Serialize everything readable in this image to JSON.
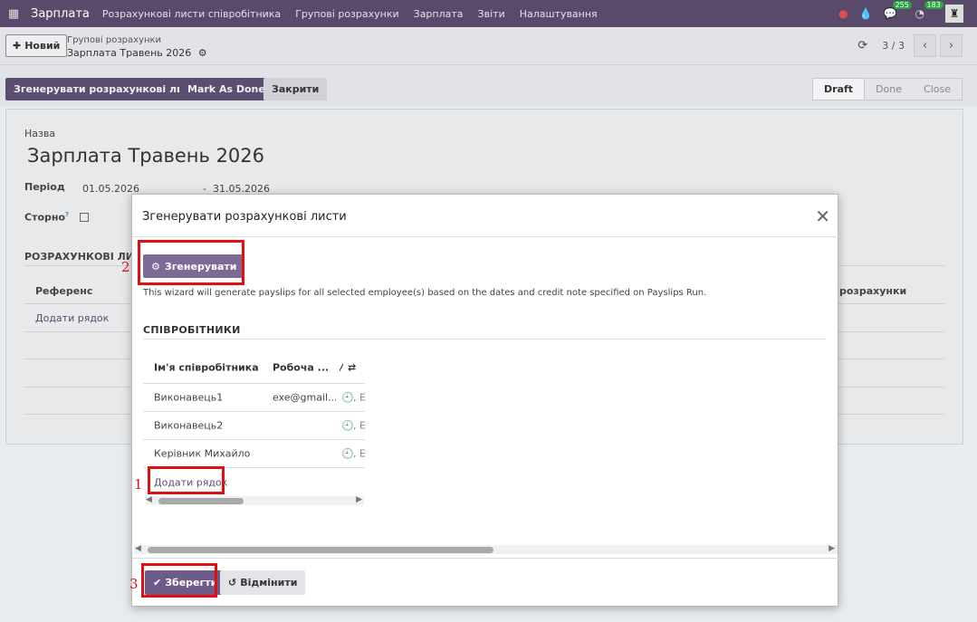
{
  "navbar": {
    "brand": "Зарплата",
    "menu": [
      "Розрахункові листи співробітника",
      "Групові розрахунки",
      "Зарплата",
      "Звіти",
      "Налаштування"
    ],
    "messages_count": "255",
    "activities_count": "183"
  },
  "control": {
    "new_label": "Новий",
    "breadcrumb_parent": "Групові розрахунки",
    "breadcrumb_current": "Зарплата Травень 2026",
    "pager": "3 / 3"
  },
  "actions": {
    "generate": "Згенерувати розрахункові листи",
    "mark_done": "Mark As Done",
    "close": "Закрити"
  },
  "statusbar": [
    "Draft",
    "Done",
    "Close"
  ],
  "form": {
    "name_label": "Назва",
    "name_value": "Зарплата Травень 2026",
    "period_label": "Період",
    "date_from": "01.05.2026",
    "date_sep": "-",
    "date_to": "31.05.2026",
    "credit_note_label": "Сторно",
    "credit_note_help": "?",
    "payslips_section": "РОЗРАХУНКОВІ ЛИСТ",
    "col_reference": "Референс",
    "col_right": "розрахунки",
    "add_line": "Додати рядок"
  },
  "modal": {
    "title": "Згенерувати розрахункові листи",
    "generate_button": "Згенерувати",
    "note": "This wizard will generate payslips for all selected employee(s) based on the dates and credit note specified on Payslips Run.",
    "section": "СПІВРОБІТНИКИ",
    "columns": [
      "Ім'я співробітника",
      "Робоча ...",
      "/"
    ],
    "rows": [
      {
        "name": "Виконавець1",
        "email": "exe@gmail....",
        "schedule": ", E"
      },
      {
        "name": "Виконавець2",
        "email": "",
        "schedule": ", E"
      },
      {
        "name": "Керівник Михайло",
        "email": "",
        "schedule": ", E"
      }
    ],
    "add_line": "Додати рядок",
    "save": "Зберегти",
    "cancel": "Відмінити"
  },
  "annotations": [
    "1",
    "2",
    "3"
  ],
  "colors": {
    "accent": "#714B67",
    "annotation": "#e01010"
  }
}
